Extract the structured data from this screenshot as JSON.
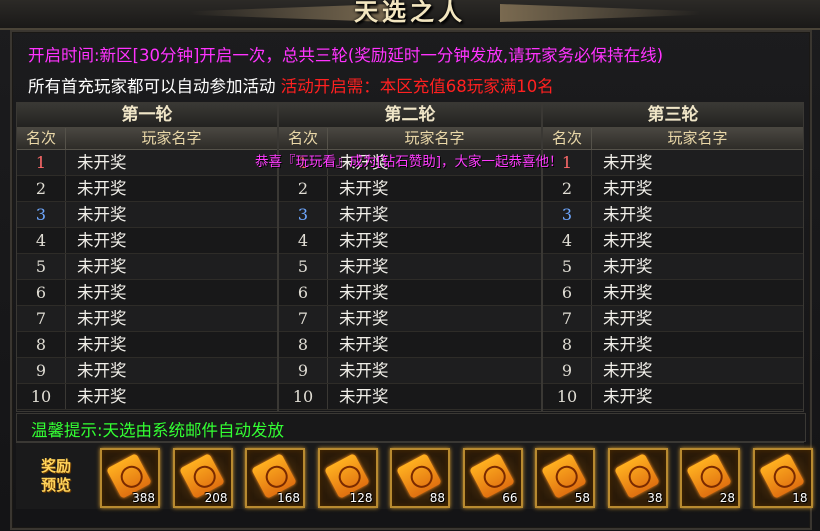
{
  "window": {
    "title": "天选之人"
  },
  "info": {
    "line1": "开启时间:新区[30分钟]开启一次，总共三轮(奖励延时一分钟发放,请玩家务必保持在线)",
    "line2_white": "所有首充玩家都可以自动参加活动",
    "line2_red": "活动开启需：本区充值68玩家满10名"
  },
  "rounds": [
    {
      "title": "第一轮",
      "rank_header": "名次",
      "name_header": "玩家名字",
      "rows": [
        {
          "rank": "1",
          "name": "未开奖"
        },
        {
          "rank": "2",
          "name": "未开奖"
        },
        {
          "rank": "3",
          "name": "未开奖"
        },
        {
          "rank": "4",
          "name": "未开奖"
        },
        {
          "rank": "5",
          "name": "未开奖"
        },
        {
          "rank": "6",
          "name": "未开奖"
        },
        {
          "rank": "7",
          "name": "未开奖"
        },
        {
          "rank": "8",
          "name": "未开奖"
        },
        {
          "rank": "9",
          "name": "未开奖"
        },
        {
          "rank": "10",
          "name": "未开奖"
        }
      ]
    },
    {
      "title": "第二轮",
      "rank_header": "名次",
      "name_header": "玩家名字",
      "rows": [
        {
          "rank": "1",
          "name": "未开奖"
        },
        {
          "rank": "2",
          "name": "未开奖"
        },
        {
          "rank": "3",
          "name": "未开奖"
        },
        {
          "rank": "4",
          "name": "未开奖"
        },
        {
          "rank": "5",
          "name": "未开奖"
        },
        {
          "rank": "6",
          "name": "未开奖"
        },
        {
          "rank": "7",
          "name": "未开奖"
        },
        {
          "rank": "8",
          "name": "未开奖"
        },
        {
          "rank": "9",
          "name": "未开奖"
        },
        {
          "rank": "10",
          "name": "未开奖"
        }
      ]
    },
    {
      "title": "第三轮",
      "rank_header": "名次",
      "name_header": "玩家名字",
      "rows": [
        {
          "rank": "1",
          "name": "未开奖"
        },
        {
          "rank": "2",
          "name": "未开奖"
        },
        {
          "rank": "3",
          "name": "未开奖"
        },
        {
          "rank": "4",
          "name": "未开奖"
        },
        {
          "rank": "5",
          "name": "未开奖"
        },
        {
          "rank": "6",
          "name": "未开奖"
        },
        {
          "rank": "7",
          "name": "未开奖"
        },
        {
          "rank": "8",
          "name": "未开奖"
        },
        {
          "rank": "9",
          "name": "未开奖"
        },
        {
          "rank": "10",
          "name": "未开奖"
        }
      ]
    }
  ],
  "notice": "恭喜『玩玩看』成为[钻石赞助]，大家一起恭喜他！",
  "tip": "温馨提示:天选由系统邮件自动发放",
  "rewards": {
    "label": "奖励预览",
    "items": [
      {
        "icon": "scroll-icon",
        "qty": "388"
      },
      {
        "icon": "scroll-icon",
        "qty": "208"
      },
      {
        "icon": "scroll-icon",
        "qty": "168"
      },
      {
        "icon": "scroll-icon",
        "qty": "128"
      },
      {
        "icon": "scroll-icon",
        "qty": "88"
      },
      {
        "icon": "scroll-icon",
        "qty": "66"
      },
      {
        "icon": "scroll-icon",
        "qty": "58"
      },
      {
        "icon": "scroll-icon",
        "qty": "38"
      },
      {
        "icon": "scroll-icon",
        "qty": "28"
      },
      {
        "icon": "scroll-icon",
        "qty": "18"
      }
    ]
  },
  "colors": {
    "magenta": "#ff33ff",
    "red": "#ff2020",
    "green": "#33ff33",
    "gold": "#ffd35a"
  }
}
